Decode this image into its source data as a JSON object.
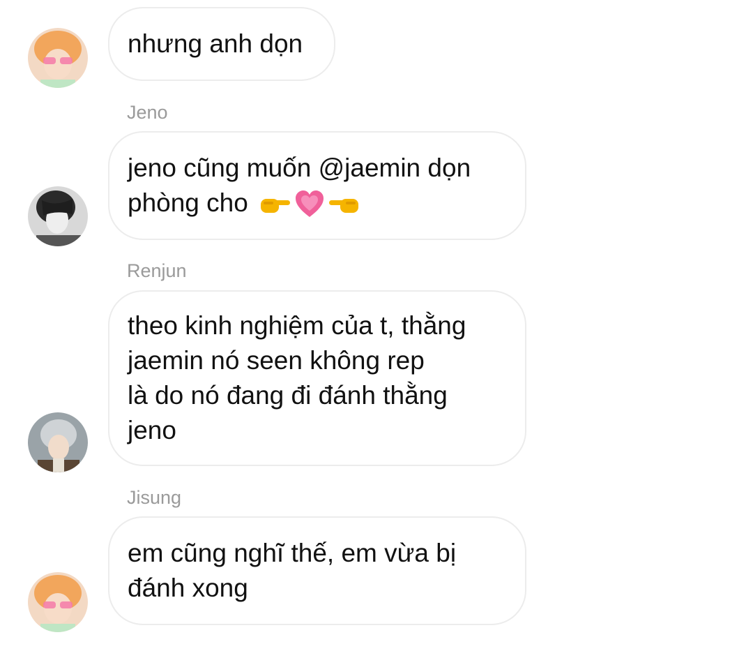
{
  "messages": [
    {
      "sender": "",
      "avatar": "avatar-orange-hair",
      "lines": [
        "nhưng anh dọn"
      ]
    },
    {
      "sender": "Jeno",
      "avatar": "avatar-dark-hair",
      "lines": [
        "jeno cũng muốn @jaemin dọn",
        "phòng cho"
      ],
      "emojis": [
        "pointing-right-hand-emoji",
        "growing-heart-emoji",
        "pointing-left-hand-emoji"
      ]
    },
    {
      "sender": "Renjun",
      "avatar": "avatar-light-hair",
      "lines": [
        "theo kinh nghiệm của t, thằng",
        "jaemin nó seen không rep",
        "là do nó đang đi đánh thằng",
        "jeno"
      ]
    },
    {
      "sender": "Jisung",
      "avatar": "avatar-orange-hair",
      "lines": [
        "em cũng nghĩ thế, em vừa bị",
        "đánh xong"
      ]
    }
  ],
  "colors": {
    "bubble_border": "#ececec",
    "sender_name": "#9a9a9a",
    "message_text": "#111111",
    "heart": "#f0609a",
    "hand": "#f5b400"
  }
}
